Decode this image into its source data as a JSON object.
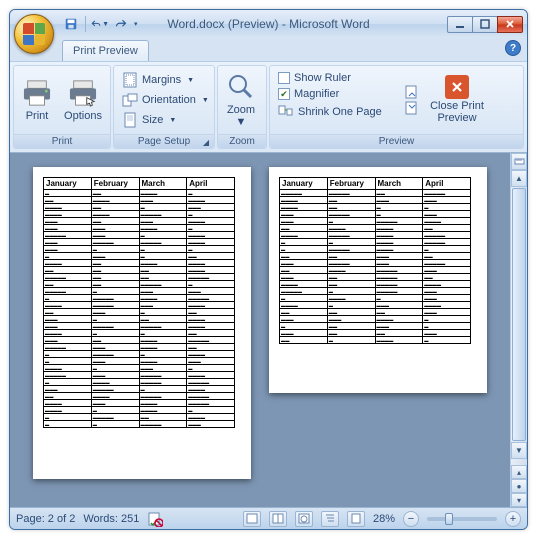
{
  "title": "Word.docx (Preview) - Microsoft Word",
  "tab": "Print Preview",
  "ribbon": {
    "print_group": "Print",
    "print": "Print",
    "options": "Options",
    "pagesetup_group": "Page Setup",
    "margins": "Margins",
    "orientation": "Orientation",
    "size": "Size",
    "zoom_group": "Zoom",
    "zoom": "Zoom",
    "preview_group": "Preview",
    "show_ruler": "Show Ruler",
    "magnifier": "Magnifier",
    "shrink": "Shrink One Page",
    "close": "Close Print Preview"
  },
  "doc": {
    "headers": [
      "January",
      "February",
      "March",
      "April"
    ]
  },
  "status": {
    "page": "Page: 2 of 2",
    "words": "Words: 251",
    "zoom": "28%"
  }
}
